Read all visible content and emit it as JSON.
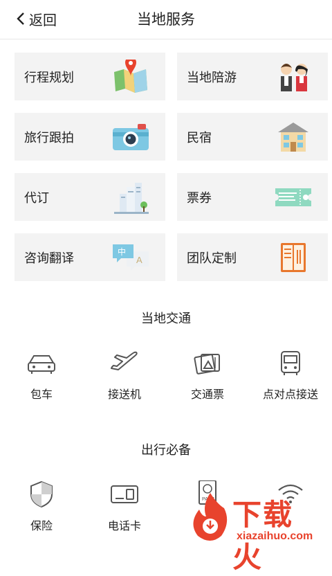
{
  "header": {
    "back_label": "返回",
    "title": "当地服务"
  },
  "services": [
    {
      "label": "行程规划",
      "icon": "map-pin-icon"
    },
    {
      "label": "当地陪游",
      "icon": "guide-couple-icon"
    },
    {
      "label": "旅行跟拍",
      "icon": "camera-icon"
    },
    {
      "label": "民宿",
      "icon": "house-icon"
    },
    {
      "label": "代订",
      "icon": "buildings-icon"
    },
    {
      "label": "票券",
      "icon": "ticket-icon"
    },
    {
      "label": "咨询翻译",
      "icon": "translate-bubble-icon"
    },
    {
      "label": "团队定制",
      "icon": "menu-book-icon"
    }
  ],
  "transport": {
    "title": "当地交通",
    "items": [
      {
        "label": "包车",
        "icon": "car-icon"
      },
      {
        "label": "接送机",
        "icon": "plane-icon"
      },
      {
        "label": "交通票",
        "icon": "tickets-icon"
      },
      {
        "label": "点对点接送",
        "icon": "bus-icon"
      }
    ]
  },
  "essentials": {
    "title": "出行必备",
    "items": [
      {
        "label": "保险",
        "icon": "shield-icon"
      },
      {
        "label": "电话卡",
        "icon": "sim-card-icon"
      },
      {
        "label": "",
        "icon": "passport-icon"
      },
      {
        "label": "",
        "icon": "wifi-icon"
      }
    ]
  },
  "watermark": {
    "text": "下载火",
    "url": "xiazaihuo.com"
  },
  "colors": {
    "accent": "#e8432d",
    "card_bg": "#f3f3f3",
    "icon_stroke": "#555555"
  }
}
